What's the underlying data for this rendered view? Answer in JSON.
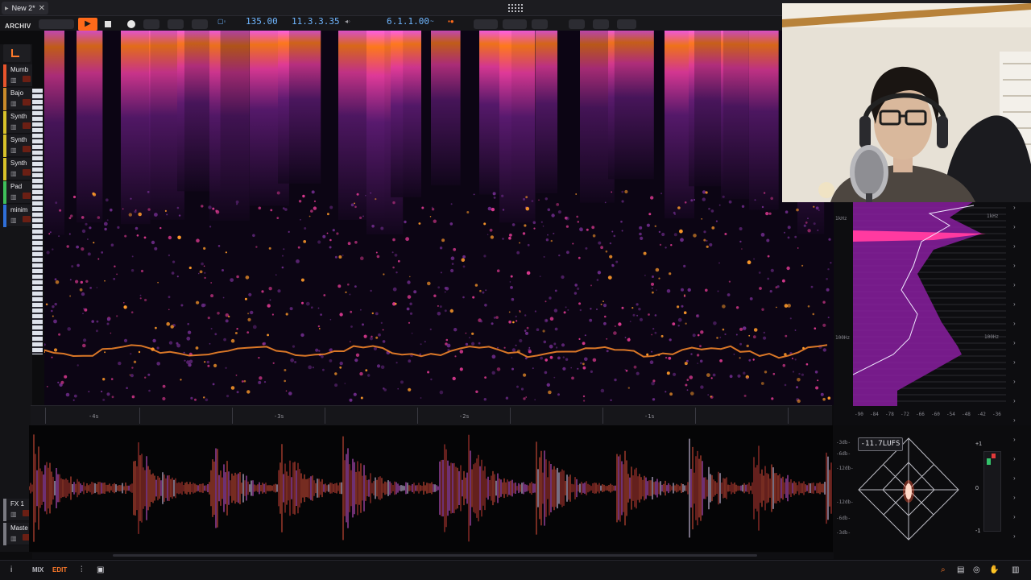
{
  "header": {
    "tab_title": "New 2*",
    "close_glyph": "✕"
  },
  "transport": {
    "archive_label": "ARCHIV",
    "tempo": "135.00",
    "position": "11.3.3.35",
    "loop_length": "6.1.1.00",
    "colors": {
      "play": "#ff6a1a",
      "value": "#6fb6ff"
    }
  },
  "tracks": [
    {
      "name": "Mumb",
      "color": "#e8542c"
    },
    {
      "name": "Bajo",
      "color": "#c98a2a"
    },
    {
      "name": "Synth",
      "color": "#d8c22a"
    },
    {
      "name": "Synth",
      "color": "#d8c22a"
    },
    {
      "name": "Synth",
      "color": "#d8c22a"
    },
    {
      "name": "Pad",
      "color": "#3fbf5a"
    },
    {
      "name": "minim",
      "color": "#2f6fd8"
    }
  ],
  "bus_tracks": [
    {
      "name": "FX 1",
      "color": "#7a7a82"
    },
    {
      "name": "Maste",
      "color": "#7a7a82"
    }
  ],
  "spectrogram": {
    "time_ticks": [
      "-4s",
      "-3s",
      "-2s",
      "-1s"
    ]
  },
  "freq_analyzer": {
    "freq_labels": [
      "1kHz",
      "100Hz"
    ],
    "freq_labels_right": [
      "1kHz",
      "100Hz"
    ],
    "db_labels": [
      "-90",
      "-84",
      "-78",
      "-72",
      "-66",
      "-60",
      "-54",
      "-48",
      "-42",
      "-36"
    ]
  },
  "waveform": {
    "db_labels": [
      "-3db-",
      "-6db-",
      "-12db-",
      "-12db-",
      "-6db-",
      "-3db-"
    ]
  },
  "loudness": {
    "lufs": "-11.7LUFS",
    "meter_labels": [
      "+1",
      "0",
      "-1"
    ]
  },
  "bottombar": {
    "info_glyph": "i",
    "mix_label": "MIX",
    "edit_label": "EDIT"
  }
}
